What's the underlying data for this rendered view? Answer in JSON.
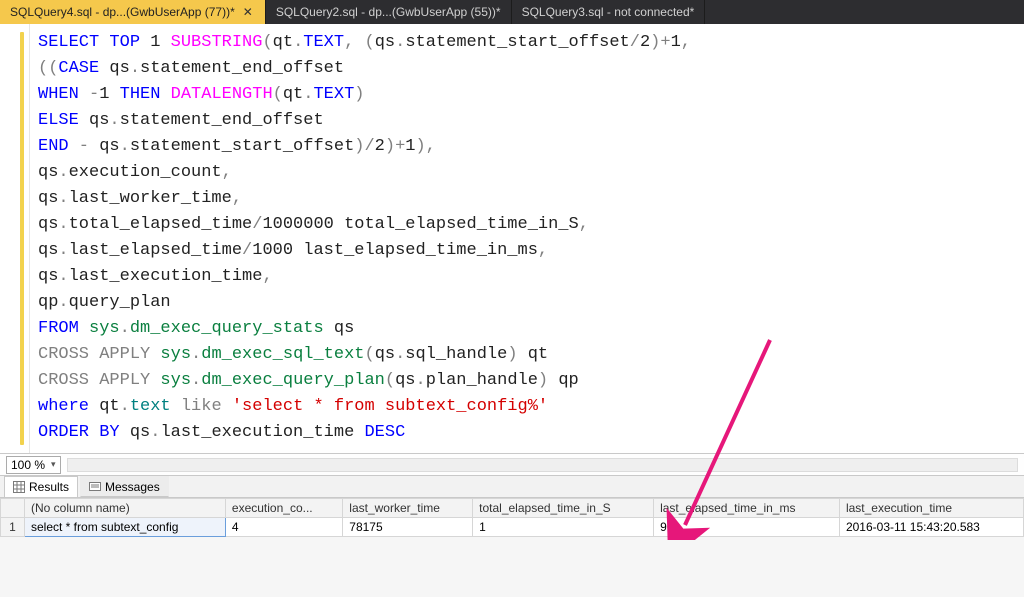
{
  "tabs": [
    {
      "label": "SQLQuery4.sql - dp...(GwbUserApp (77))*",
      "close": "✕"
    },
    {
      "label": "SQLQuery2.sql - dp...(GwbUserApp (55))*"
    },
    {
      "label": "SQLQuery3.sql - not connected*"
    }
  ],
  "code": {
    "l1": {
      "a": "SELECT",
      "b": " TOP",
      "c": " 1 ",
      "d": "SUBSTRING",
      "e": "(",
      "f": "qt",
      "g": ".",
      "h": "TEXT",
      "i": ",",
      "j": " (",
      "k": "qs",
      "l": ".",
      "m": "statement_start_offset",
      "n": "/",
      "o": "2",
      "p": ")+",
      "q": "1",
      "r": ","
    },
    "l2": {
      "a": "((",
      "b": "CASE",
      "c": " qs",
      "d": ".",
      "e": "statement_end_offset"
    },
    "l3": {
      "a": "WHEN",
      "b": " -",
      "c": "1",
      "d": " THEN",
      "e": " DATALENGTH",
      "f": "(",
      "g": "qt",
      "h": ".",
      "i": "TEXT",
      "j": ")"
    },
    "l4": {
      "a": "ELSE",
      "b": " qs",
      "c": ".",
      "d": "statement_end_offset"
    },
    "l5": {
      "a": "END",
      "b": " -",
      "c": " qs",
      "d": ".",
      "e": "statement_start_offset",
      "f": ")/",
      "g": "2",
      "h": ")+",
      "i": "1",
      "j": "),"
    },
    "l6": {
      "a": "qs",
      "b": ".",
      "c": "execution_count",
      "d": ","
    },
    "l7": {
      "a": "qs",
      "b": ".",
      "c": "last_worker_time",
      "d": ","
    },
    "l8": {
      "a": "qs",
      "b": ".",
      "c": "total_elapsed_time",
      "d": "/",
      "e": "1000000",
      "f": " total_elapsed_time_in_S",
      "g": ","
    },
    "l9": {
      "a": "qs",
      "b": ".",
      "c": "last_elapsed_time",
      "d": "/",
      "e": "1000",
      "f": " last_elapsed_time_in_ms",
      "g": ","
    },
    "l10": {
      "a": "qs",
      "b": ".",
      "c": "last_execution_time",
      "d": ","
    },
    "l11": {
      "a": "qp",
      "b": ".",
      "c": "query_plan"
    },
    "l12": {
      "a": "FROM",
      "b": " sys",
      "c": ".",
      "d": "dm_exec_query_stats",
      "e": " qs"
    },
    "l13": {
      "a": "CROSS",
      "b": " APPLY",
      "c": " sys",
      "d": ".",
      "e": "dm_exec_sql_text",
      "f": "(",
      "g": "qs",
      "h": ".",
      "i": "sql_handle",
      "j": ")",
      "k": " qt"
    },
    "l14": {
      "a": "CROSS",
      "b": " APPLY",
      "c": " sys",
      "d": ".",
      "e": "dm_exec_query_plan",
      "f": "(",
      "g": "qs",
      "h": ".",
      "i": "plan_handle",
      "j": ")",
      "k": " qp"
    },
    "l15": {
      "a": "where",
      "b": " qt",
      "c": ".",
      "d": "text",
      "e": " like",
      "f": " 'select * from subtext_config%'"
    },
    "l16": {
      "a": "ORDER",
      "b": " BY",
      "c": " qs",
      "d": ".",
      "e": "last_execution_time",
      "f": " DESC"
    }
  },
  "zoom": {
    "value": "100 %"
  },
  "panel": {
    "results": "Results",
    "messages": "Messages"
  },
  "grid": {
    "headers": [
      "(No column name)",
      "execution_co...",
      "last_worker_time",
      "total_elapsed_time_in_S",
      "last_elapsed_time_in_ms",
      "last_execution_time"
    ],
    "row": {
      "num": "1",
      "c0": "select * from subtext_config",
      "c1": "4",
      "c2": "78175",
      "c3": "1",
      "c4": "96",
      "c5": "2016-03-11 15:43:20.583"
    }
  }
}
